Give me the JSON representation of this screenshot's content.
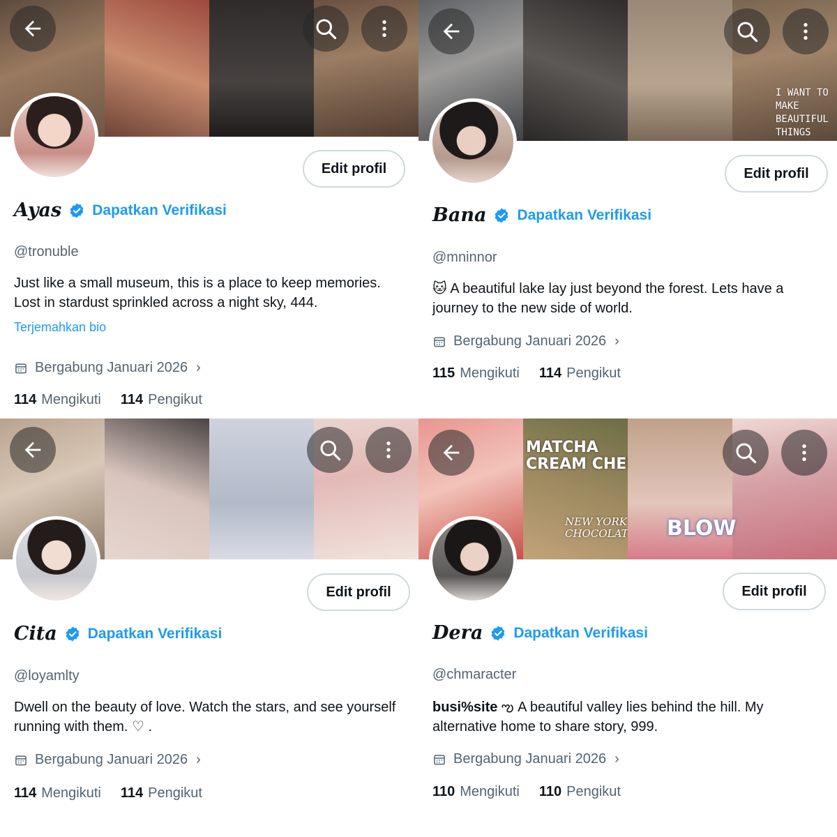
{
  "common": {
    "edit_label": "Edit profil",
    "get_verified": "Dapatkan Verifikasi",
    "following_label": "Mengikuti",
    "followers_label": "Pengikut",
    "verified_color": "#1d9bf0"
  },
  "profiles": [
    {
      "name": "Ayas",
      "handle": "@tronuble",
      "bio_line1": "Just like a small museum, this is a place to keep memories.",
      "bio_line2": "Lost in stardust sprinkled across a night sky, 444.",
      "translate": "Terjemahkan bio",
      "joined": "Bergabung Januari 2026",
      "following": "114",
      "followers": "114"
    },
    {
      "name": "Bana",
      "handle": "@mninnor",
      "bio_emoji": "🐱",
      "bio_line1": "A beautiful lake lay just beyond the forest. Lets have a",
      "bio_line2": "journey to the new side of world.",
      "joined": "Bergabung Januari 2026",
      "following": "115",
      "followers": "114"
    },
    {
      "name": "Cita",
      "handle": "@loyamlty",
      "bio_line1": "Dwell on the beauty of love. Watch the stars, and see yourself",
      "bio_line2": "running with them. ♡ .",
      "joined": "Bergabung Januari 2026",
      "following": "114",
      "followers": "114"
    },
    {
      "name": "Dera",
      "handle": "@chmaracter",
      "bio_bold": "busi%site",
      "bio_emoji": "ఌ",
      "bio_line1": "A beautiful valley lies behind the hill. My",
      "bio_line2": "alternative home to share story, 999.",
      "joined": "Bergabung Januari 2026",
      "following": "110",
      "followers": "110"
    }
  ],
  "banners": [
    [
      "#8a6a52",
      "#a4554a",
      "#3a3634",
      "#7b5e49"
    ],
    [
      "#6b6e72",
      "#4d4b49",
      "#a48f77",
      "#7c6a52"
    ],
    [
      "#c6b6a8",
      "#d9c9c2",
      "#bfc2cf",
      "#e3c9c4"
    ],
    [
      "#e7a7a2",
      "#8e8a5e",
      "#d7c2b8",
      "#c9a0a3"
    ]
  ],
  "banner_texts": {
    "p1": "I WANT TO MAKE BEAUTIFUL THINGS",
    "p3_top": "MATCHA CREAM CHEES",
    "p3_mid": "NEW YORK CHOCOLATE",
    "p3_right": "BLOW"
  },
  "icons": {
    "back": "arrow-left-icon",
    "search": "search-icon",
    "more": "more-vertical-icon",
    "verified": "verified-badge-icon",
    "calendar": "calendar-icon",
    "chevron": "chevron-right-icon"
  }
}
